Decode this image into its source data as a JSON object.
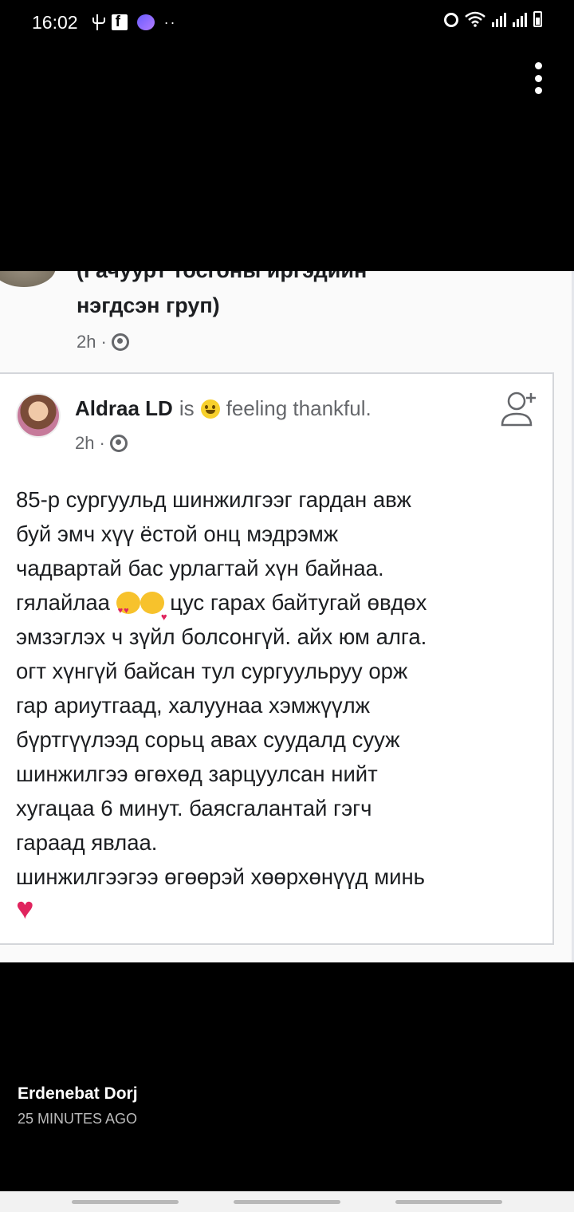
{
  "status_bar": {
    "time": "16:02"
  },
  "post_header": {
    "group_title_partial": "(Гачуурт тосгоны иргэдийн",
    "group_title": "нэгдсэн груп)",
    "time": "2h",
    "privacy_icon": "globe-icon"
  },
  "post": {
    "author": "Aldraa LD",
    "is_text": "is",
    "feeling_text": "feeling thankful.",
    "time": "2h",
    "lines": [
      "85-р сургуульд шинжилгээг гардан авж",
      "буй эмч хүү ёстой онц мэдрэмж",
      "чадвартай бас урлагтай хүн байнаа.",
      "гялайлаа",
      "цус гарах байтугай өвдөх",
      "эмзэглэх ч зүйл болсонгүй. айх юм алга.",
      "огт хүнгүй байсан тул сургуульруу орж",
      "гар ариутгаад, халуунаа хэмжүүлж",
      "бүртгүүлээд сорьц авах суудалд сууж",
      "шинжилгээ өгөхөд зарцуулсан нийт",
      "хугацаа 6 минут. баясгалантай гэгч",
      "гараад явлаа.",
      "шинжилгээгээ өгөөрэй хөөрхөнүүд минь"
    ]
  },
  "footer": {
    "poster_name": "Erdenebat Dorj",
    "poster_time": "25 MINUTES AGO"
  }
}
